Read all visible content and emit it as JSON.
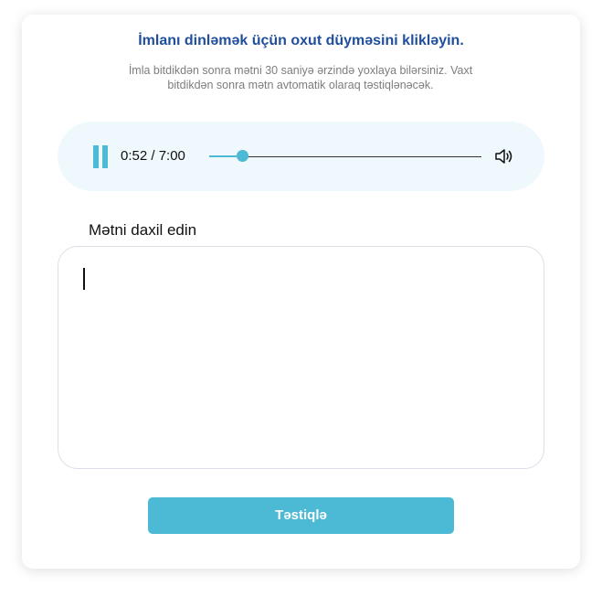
{
  "header": {
    "title": "İmlanı dinləmək üçün oxut düyməsini klikləyin.",
    "subtitle": "İmla bitdikdən sonra mətni 30 saniyə ərzində yoxlaya bilərsiniz. Vaxt bitdikdən sonra mətn avtomatik olaraq təstiqlənəcək."
  },
  "player": {
    "state": "playing",
    "time_display": "0:52 / 7:00",
    "progress": 0.124,
    "pause_icon": "pause-icon",
    "volume_icon": "speaker-icon",
    "accent_color": "#4cb9d5",
    "background_color": "#eff8fc"
  },
  "form": {
    "label": "Mətni daxil edin",
    "value": "",
    "submit_label": "Təstiqlə",
    "button_color": "#4cb9d5"
  },
  "colors": {
    "title": "#1f4f9c",
    "subtitle": "#7d7d7d"
  }
}
